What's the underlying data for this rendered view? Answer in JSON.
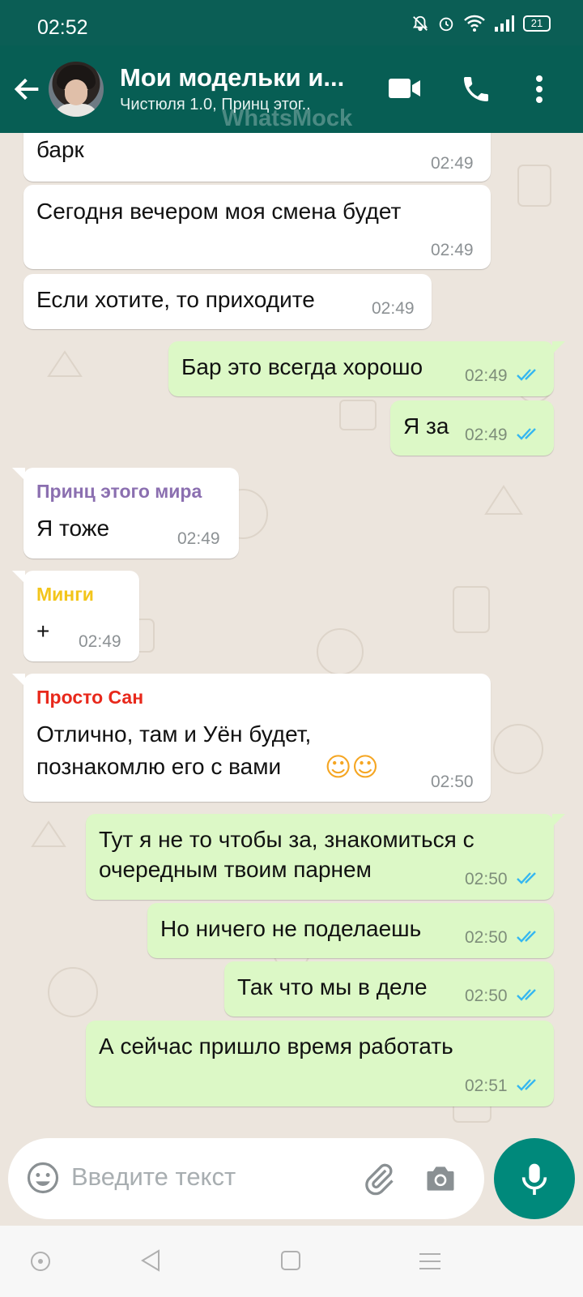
{
  "status_bar": {
    "time": "02:52",
    "battery": "21"
  },
  "header": {
    "title": "Мои модельки и...",
    "subtitle": "Чистюля 1.0, Принц этог..",
    "watermark": "WhatsMock"
  },
  "messages": [
    {
      "direction": "in",
      "sender": "",
      "text": [
        "барк"
      ],
      "time": "02:49"
    },
    {
      "direction": "in",
      "sender": "",
      "text": [
        "Сегодня вечером моя смена будет"
      ],
      "time": "02:49"
    },
    {
      "direction": "in",
      "sender": "",
      "text": [
        "Если хотите, то приходите"
      ],
      "time": "02:49"
    },
    {
      "direction": "out",
      "text": [
        "Бар это всегда хорошо"
      ],
      "time": "02:49",
      "status": "read"
    },
    {
      "direction": "out",
      "text": [
        "Я за"
      ],
      "time": "02:49",
      "status": "read"
    },
    {
      "direction": "in",
      "sender": "Принц этого мира",
      "sender_color": "#8b6fb0",
      "text": [
        "Я тоже"
      ],
      "time": "02:49"
    },
    {
      "direction": "in",
      "sender": "Минги",
      "sender_color": "#f3c51b",
      "text": [
        "+"
      ],
      "time": "02:49"
    },
    {
      "direction": "in",
      "sender": "Просто Сан",
      "sender_color": "#e8281b",
      "text": [
        "Отлично, там и Уён будет,",
        "познакомлю его с вами"
      ],
      "emoji": "☺☺",
      "time": "02:50"
    },
    {
      "direction": "out",
      "text": [
        "Тут я не то чтобы за, знакомиться с",
        "очередным твоим парнем"
      ],
      "time": "02:50",
      "status": "read"
    },
    {
      "direction": "out",
      "text": [
        "Но ничего не поделаешь"
      ],
      "time": "02:50",
      "status": "read"
    },
    {
      "direction": "out",
      "text": [
        "Так что мы в деле"
      ],
      "time": "02:50",
      "status": "read"
    },
    {
      "direction": "out",
      "text": [
        "А сейчас пришло время работать"
      ],
      "time": "02:51",
      "status": "read"
    }
  ],
  "composer": {
    "placeholder": "Введите текст"
  },
  "colors": {
    "header": "#075e54",
    "status_bar": "#0b5e55",
    "outgoing": "#dcf8c6",
    "incoming": "#ffffff",
    "read_ticks": "#34b7f1",
    "mic_button": "#00897b"
  },
  "icons": [
    "back-arrow-icon",
    "video-call-icon",
    "voice-call-icon",
    "more-options-icon",
    "emoji-icon",
    "attach-icon",
    "camera-icon",
    "microphone-icon",
    "mute-icon",
    "alarm-icon",
    "wifi-icon",
    "signal-icon",
    "battery-icon"
  ]
}
